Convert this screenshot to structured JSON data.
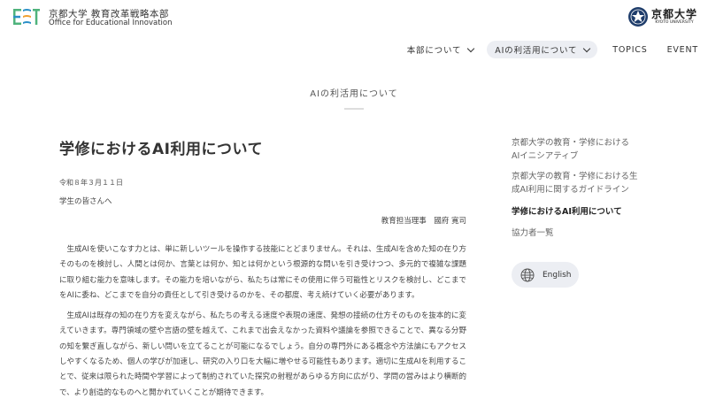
{
  "header": {
    "org_name_ja": "京都大学 教育改革戦略本部",
    "org_name_en": "Office for Educational Innovation",
    "university_ja": "京都大学",
    "university_en": "KYOTO UNIVERSITY"
  },
  "nav": {
    "items": [
      {
        "label": "本部について"
      },
      {
        "label": "AIの利活用について"
      },
      {
        "label": "TOPICS"
      },
      {
        "label": "EVENT"
      }
    ]
  },
  "page": {
    "section_title": "AIの利活用について"
  },
  "article": {
    "headline": "学修におけるAI利用について",
    "date": "令和８年３月１１日",
    "greeting": "学生の皆さんへ",
    "signature": "教育担当理事　國府 寛司",
    "paragraphs": [
      "生成AIを使いこなす力とは、単に新しいツールを操作する技能にとどまりません。それは、生成AIを含めた知の在り方そのものを検討し、人間とは何か、言葉とは何か、知とは何かという根源的な問いを引き受けつつ、多元的で複雑な課題に取り組む能力を意味します。その能力を培いながら、私たちは常にその使用に伴う可能性とリスクを検討し、どこまでをAIに委ね、どこまでを自分の責任として引き受けるのかを、その都度、考え続けていく必要があります。",
      "生成AIは既存の知の在り方を変えながら、私たちの考える速度や表現の速度、発想の接続の仕方そのものを抜本的に変えていきます。専門領域の壁や言語の壁を越えて、これまで出会えなかった資料や議論を参照できることで、異なる分野の知を繋ぎ直しながら、新しい問いを立てることが可能になるでしょう。自分の専門外にある概念や方法論にもアクセスしやすくなるため、個人の学びが加速し、研究の入り口を大幅に増やせる可能性もあります。適切に生成AIを利用することで、従来は限られた時間や学習によって制約されていた探究の射程があらゆる方向に広がり、学問の営みはより横断的で、より創造的なものへと開かれていくことが期待できます。"
    ]
  },
  "sidebar": {
    "items": [
      {
        "label": "京都大学の教育・学修における\nAIイニシアティブ"
      },
      {
        "label": "京都大学の教育・学修における生\n成AI利用に関するガイドライン"
      },
      {
        "label": "学修におけるAI利用について"
      },
      {
        "label": "協力者一覧"
      }
    ],
    "language_button": "English"
  },
  "icons": {
    "logo": "office-logo-icon",
    "seal": "kyoto-university-seal-icon",
    "chevron": "chevron-down-icon",
    "globe": "globe-icon"
  },
  "colors": {
    "accent_bg": "#eceef3",
    "text": "#333333",
    "logo_green": "#4fb37c",
    "logo_blue": "#2a8fc7",
    "logo_orange": "#f0a030",
    "seal_navy": "#1f3d6b"
  }
}
